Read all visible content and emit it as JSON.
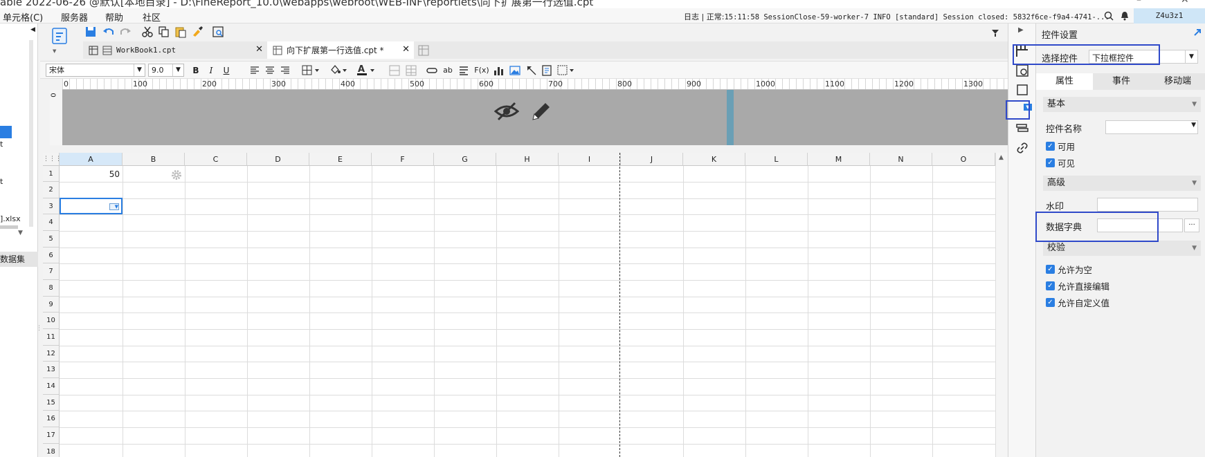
{
  "window": {
    "title": "able 2022-06-26 @默认[本地目录] - D:\\FineReport_10.0\\webapps\\webroot\\WEB-INF\\reportlets\\向下扩展第一行选值.cpt",
    "minimize_glyph": "–",
    "close_glyph": "✕"
  },
  "menubar": {
    "items": [
      "单元格(C)",
      "服务器",
      "帮助",
      "社区"
    ],
    "status_log_label": "日志",
    "status_sep": "|",
    "status_level": "正常:",
    "status_message": "15:11:58 SessionClose-59-worker-7 INFO [standard] Session closed: 5832f6ce-f9a4-4741-...",
    "user": "Z4u3z1",
    "search_icon": "search-icon",
    "bell_icon": "bell-icon"
  },
  "left_panel": {
    "item_t1": "t",
    "item_t2": "t",
    "file_label": "].xlsx",
    "dataset_label": "数据集"
  },
  "tabs": [
    {
      "label": "WorkBook1.cpt",
      "close": "✕"
    },
    {
      "label": "向下扩展第一行选值.cpt *",
      "close": "✕"
    }
  ],
  "format_bar": {
    "font": "宋体",
    "size": "9.0",
    "bold": "B",
    "italic": "I",
    "underline": "U",
    "text_ab": "ab",
    "formula": "F(x)"
  },
  "ruler": {
    "ticks": [
      "0",
      "100",
      "200",
      "300",
      "400",
      "500",
      "600",
      "700",
      "800",
      "900",
      "1000",
      "1100",
      "1200",
      "1300"
    ],
    "vertical_zero": "0"
  },
  "grid": {
    "columns": [
      "A",
      "B",
      "C",
      "D",
      "E",
      "F",
      "G",
      "H",
      "I",
      "J",
      "K",
      "L",
      "M",
      "N",
      "O"
    ],
    "rows": [
      "1",
      "2",
      "3",
      "4",
      "5",
      "6",
      "7",
      "8",
      "9",
      "10",
      "11",
      "12",
      "13",
      "14",
      "15",
      "16",
      "17",
      "18"
    ],
    "cell_a1": "50",
    "selected_cell": "A3"
  },
  "settings": {
    "title": "控件设置",
    "select_widget_label": "选择控件",
    "select_widget_value": "下拉框控件",
    "tabs": [
      "属性",
      "事件",
      "移动端"
    ],
    "active_tab": "属性",
    "sections": {
      "basic": "基本",
      "advanced": "高级",
      "validation": "校验"
    },
    "props": {
      "widget_name": "控件名称",
      "enabled": "可用",
      "visible": "可见",
      "watermark": "水印",
      "dictionary": "数据字典",
      "dictionary_btn": "···",
      "allow_empty": "允许为空",
      "allow_edit": "允许直接编辑",
      "allow_custom": "允许自定义值"
    },
    "checkmark": "✓",
    "accent_color": "#2a7ee2",
    "highlight_color": "#2f49c9"
  }
}
